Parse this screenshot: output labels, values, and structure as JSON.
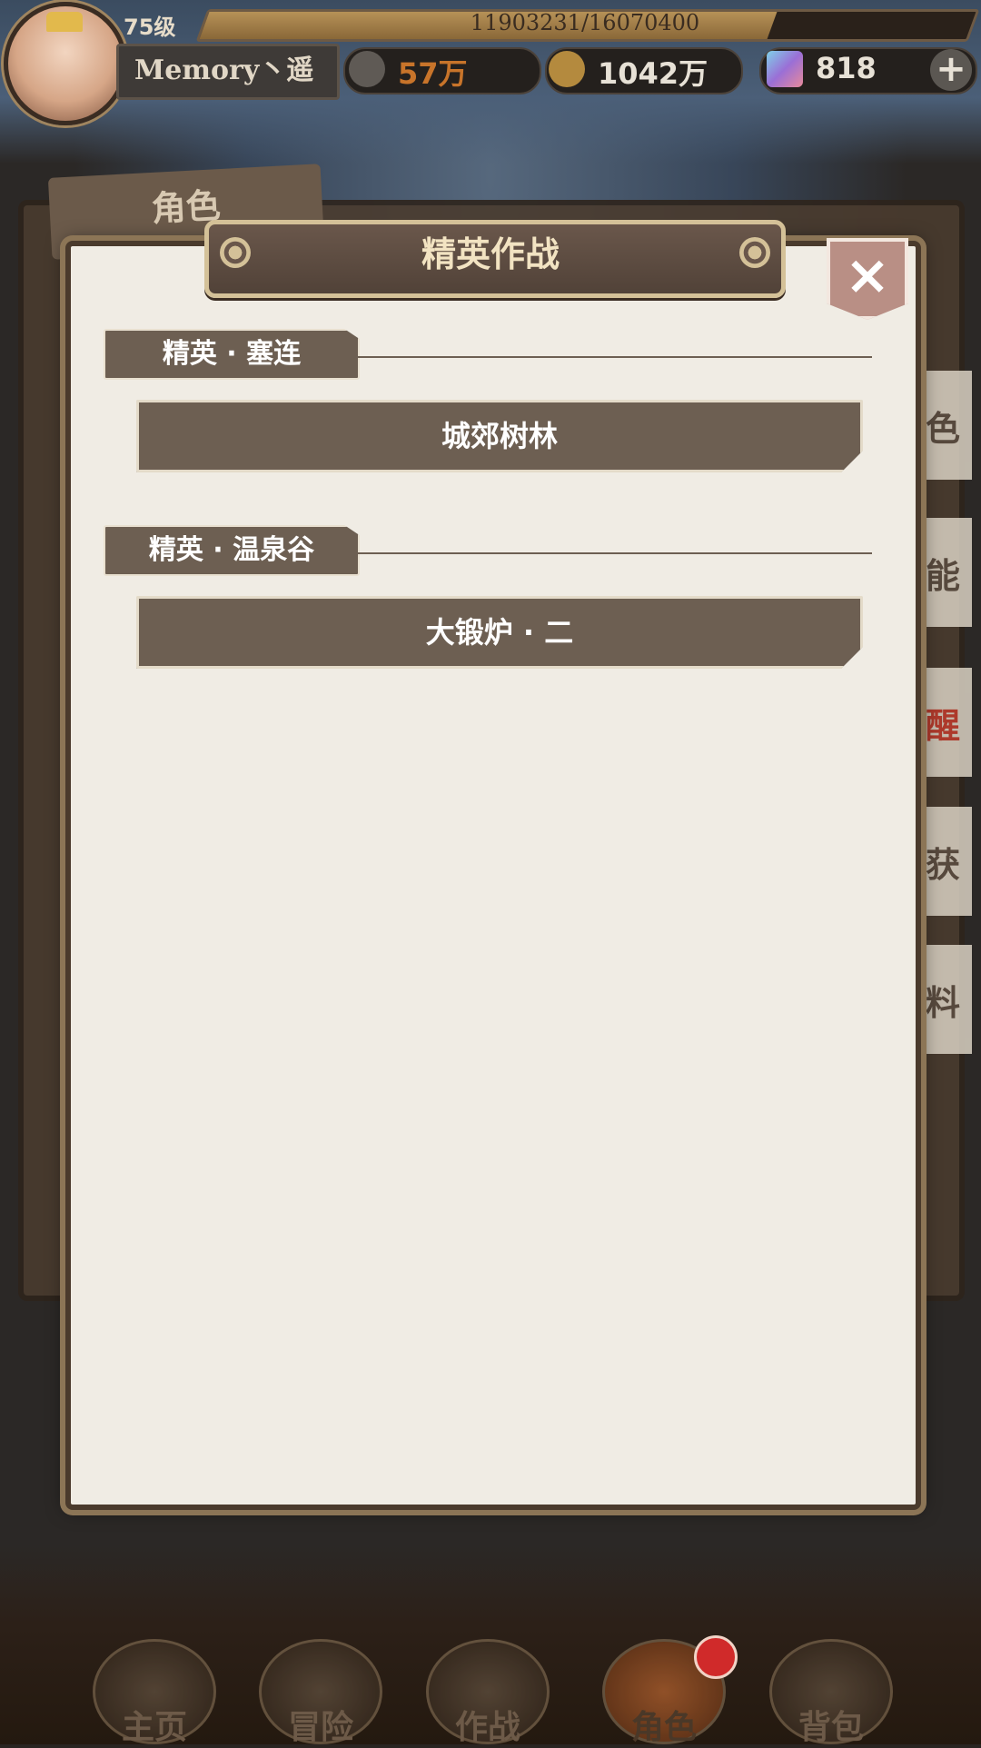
{
  "player": {
    "level": "75级",
    "exp_text": "11903231/16070400",
    "exp_fraction": 0.741,
    "name": "Memory丶遥"
  },
  "stats": {
    "power": "57万",
    "gold": "1042万",
    "gems": "818"
  },
  "background_tabs": {
    "main_tab": "角色",
    "side_tabs": [
      "色",
      "能",
      "醒",
      "获",
      "料"
    ]
  },
  "modal": {
    "title": "精英作战",
    "sections": [
      {
        "label": "精英 · 塞连",
        "stages": [
          "城郊树林"
        ]
      },
      {
        "label": "精英 · 温泉谷",
        "stages": [
          "大锻炉 · 二"
        ]
      }
    ]
  },
  "nav": {
    "items": [
      "主页",
      "冒险",
      "作战",
      "角色",
      "背包"
    ]
  },
  "colors": {
    "accent_brown": "#6d5f52",
    "power_orange": "#c8742a",
    "paper": "#f0ece4"
  }
}
